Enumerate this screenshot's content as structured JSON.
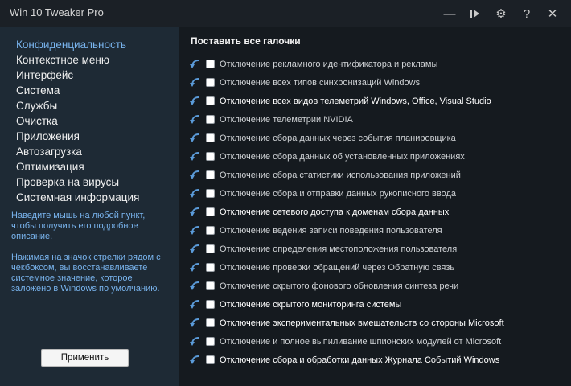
{
  "window": {
    "title": "Win 10 Tweaker Pro",
    "buttons": [
      {
        "icon": "minimize-icon",
        "glyph": "—"
      },
      {
        "icon": "play-bar-icon",
        "glyph": "⏵"
      },
      {
        "icon": "gear-icon",
        "glyph": "⚙"
      },
      {
        "icon": "help-icon",
        "glyph": "?"
      },
      {
        "icon": "close-icon",
        "glyph": "✕"
      }
    ]
  },
  "sidebar": {
    "items": [
      {
        "label": "Конфиденциальность",
        "active": true
      },
      {
        "label": "Контекстное меню"
      },
      {
        "label": "Интерфейс"
      },
      {
        "label": "Система"
      },
      {
        "label": "Службы"
      },
      {
        "label": "Очистка"
      },
      {
        "label": "Приложения"
      },
      {
        "label": "Автозагрузка"
      },
      {
        "label": "Оптимизация"
      },
      {
        "label": "Проверка на вирусы"
      },
      {
        "label": "Системная информация"
      }
    ],
    "hint_hover": "Наведите мышь на любой пункт, чтобы получить его подробное описание.",
    "hint_arrow": "Нажимая на значок стрелки рядом с чекбоксом, вы восстанавливаете системное значение, которое заложено в Windows по умолчанию.",
    "apply_label": "Применить"
  },
  "main": {
    "check_all_label": "Поставить все галочки",
    "colors": {
      "arrow": "#5b9bd9",
      "accent": "#79b4ee"
    },
    "options": [
      {
        "label": "Отключение рекламного идентификатора и рекламы"
      },
      {
        "label": "Отключение всех типов синхронизаций Windows"
      },
      {
        "label": "Отключение всех видов телеметрий Windows, Office, Visual Studio",
        "bright": true
      },
      {
        "label": "Отключение телеметрии NVIDIA"
      },
      {
        "label": "Отключение сбора данных через события планировщика"
      },
      {
        "label": "Отключение сбора данных об установленных приложениях"
      },
      {
        "label": "Отключение сбора статистики использования приложений"
      },
      {
        "label": "Отключение сбора и отправки данных рукописного ввода"
      },
      {
        "label": "Отключение сетевого доступа к доменам сбора данных",
        "bright": true
      },
      {
        "label": "Отключение ведения записи поведения пользователя"
      },
      {
        "label": "Отключение определения местоположения пользователя"
      },
      {
        "label": "Отключение проверки обращений через Обратную связь"
      },
      {
        "label": "Отключение скрытого фонового обновления синтеза речи"
      },
      {
        "label": "Отключение скрытого мониторинга системы",
        "bright": true
      },
      {
        "label": "Отключение экспериментальных вмешательств со стороны Microsoft",
        "bright": true
      },
      {
        "label": "Отключение и полное выпиливание шпионских модулей от Microsoft"
      },
      {
        "label": "Отключение сбора и обработки данных Журнала Событий Windows",
        "bright": true
      }
    ]
  }
}
